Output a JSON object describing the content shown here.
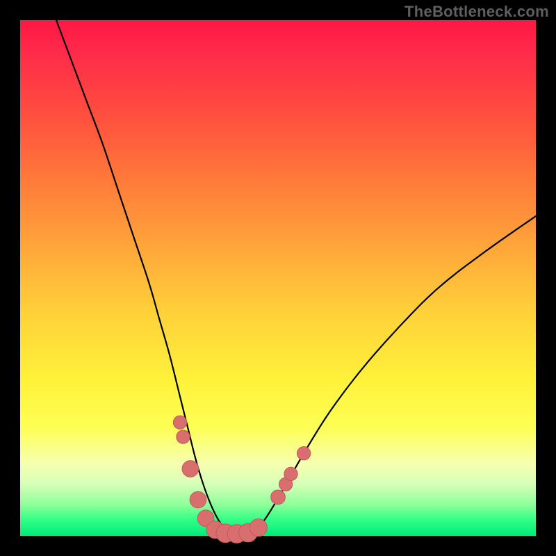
{
  "watermark": "TheBottleneck.com",
  "colors": {
    "frame": "#000000",
    "curve_stroke": "#000000",
    "marker_fill": "#d86e6e",
    "marker_stroke": "#c45a5a"
  },
  "chart_data": {
    "type": "line",
    "title": "",
    "xlabel": "",
    "ylabel": "",
    "xlim": [
      0,
      100
    ],
    "ylim": [
      0,
      100
    ],
    "grid": false,
    "legend": false,
    "series": [
      {
        "name": "bottleneck-curve",
        "x": [
          7,
          10,
          13,
          16,
          19,
          22,
          25,
          27,
          29,
          31,
          32.5,
          34,
          35.5,
          37,
          38.5,
          40,
          42,
          44,
          46,
          48,
          51,
          55,
          60,
          66,
          73,
          81,
          90,
          100
        ],
        "y": [
          100,
          92,
          84,
          76,
          67,
          58,
          49,
          42,
          35,
          27,
          21,
          15,
          10,
          6,
          3,
          1.2,
          0.4,
          0.4,
          1.5,
          4,
          9,
          16,
          24,
          32,
          40,
          48,
          55,
          62
        ]
      }
    ],
    "markers": [
      {
        "x": 31.0,
        "y": 22.0,
        "r": 1.3
      },
      {
        "x": 31.6,
        "y": 19.2,
        "r": 1.3
      },
      {
        "x": 33.0,
        "y": 13.0,
        "r": 1.6
      },
      {
        "x": 34.5,
        "y": 7.0,
        "r": 1.6
      },
      {
        "x": 36.0,
        "y": 3.4,
        "r": 1.6
      },
      {
        "x": 37.8,
        "y": 1.2,
        "r": 1.7
      },
      {
        "x": 39.8,
        "y": 0.5,
        "r": 1.8
      },
      {
        "x": 42.0,
        "y": 0.4,
        "r": 1.8
      },
      {
        "x": 44.2,
        "y": 0.6,
        "r": 1.8
      },
      {
        "x": 46.2,
        "y": 1.6,
        "r": 1.7
      },
      {
        "x": 50.0,
        "y": 7.5,
        "r": 1.4
      },
      {
        "x": 51.5,
        "y": 10.0,
        "r": 1.3
      },
      {
        "x": 52.5,
        "y": 12.0,
        "r": 1.3
      },
      {
        "x": 55.0,
        "y": 16.0,
        "r": 1.3
      }
    ]
  }
}
